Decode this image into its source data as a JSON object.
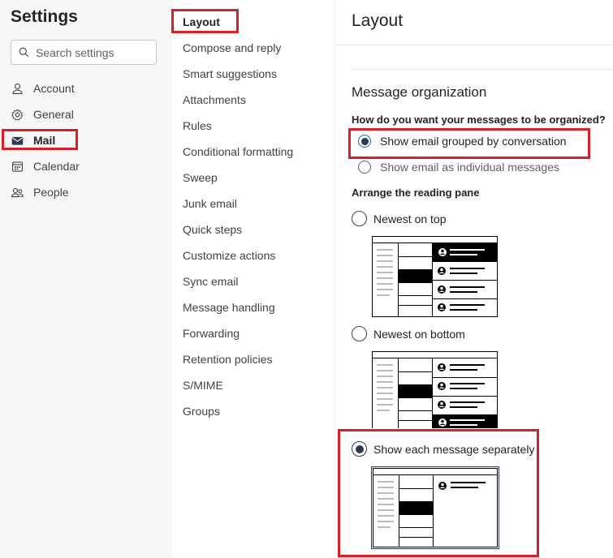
{
  "settings": {
    "title": "Settings",
    "search_placeholder": "Search settings",
    "nav": [
      {
        "label": "Account",
        "icon": "person-icon"
      },
      {
        "label": "General",
        "icon": "gear-icon"
      },
      {
        "label": "Mail",
        "icon": "mail-icon",
        "active": true
      },
      {
        "label": "Calendar",
        "icon": "calendar-icon"
      },
      {
        "label": "People",
        "icon": "people-icon"
      }
    ]
  },
  "submenu": {
    "items": [
      {
        "label": "Layout",
        "active": true
      },
      {
        "label": "Compose and reply"
      },
      {
        "label": "Smart suggestions"
      },
      {
        "label": "Attachments"
      },
      {
        "label": "Rules"
      },
      {
        "label": "Conditional formatting"
      },
      {
        "label": "Sweep"
      },
      {
        "label": "Junk email"
      },
      {
        "label": "Quick steps"
      },
      {
        "label": "Customize actions"
      },
      {
        "label": "Sync email"
      },
      {
        "label": "Message handling"
      },
      {
        "label": "Forwarding"
      },
      {
        "label": "Retention policies"
      },
      {
        "label": "S/MIME"
      },
      {
        "label": "Groups"
      }
    ]
  },
  "content": {
    "title": "Layout",
    "section_title": "Message organization",
    "question": "How do you want your messages to be organized?",
    "org_options": [
      {
        "label": "Show email grouped by conversation",
        "checked": true
      },
      {
        "label": "Show email as individual messages",
        "checked": false
      }
    ],
    "reading_pane_title": "Arrange the reading pane",
    "pane_options": [
      {
        "label": "Newest on top",
        "checked": false
      },
      {
        "label": "Newest on bottom",
        "checked": false
      },
      {
        "label": "Show each message separately",
        "checked": true
      }
    ]
  },
  "colors": {
    "highlight": "#d61f26",
    "radio_checked": "#2b3a55"
  }
}
